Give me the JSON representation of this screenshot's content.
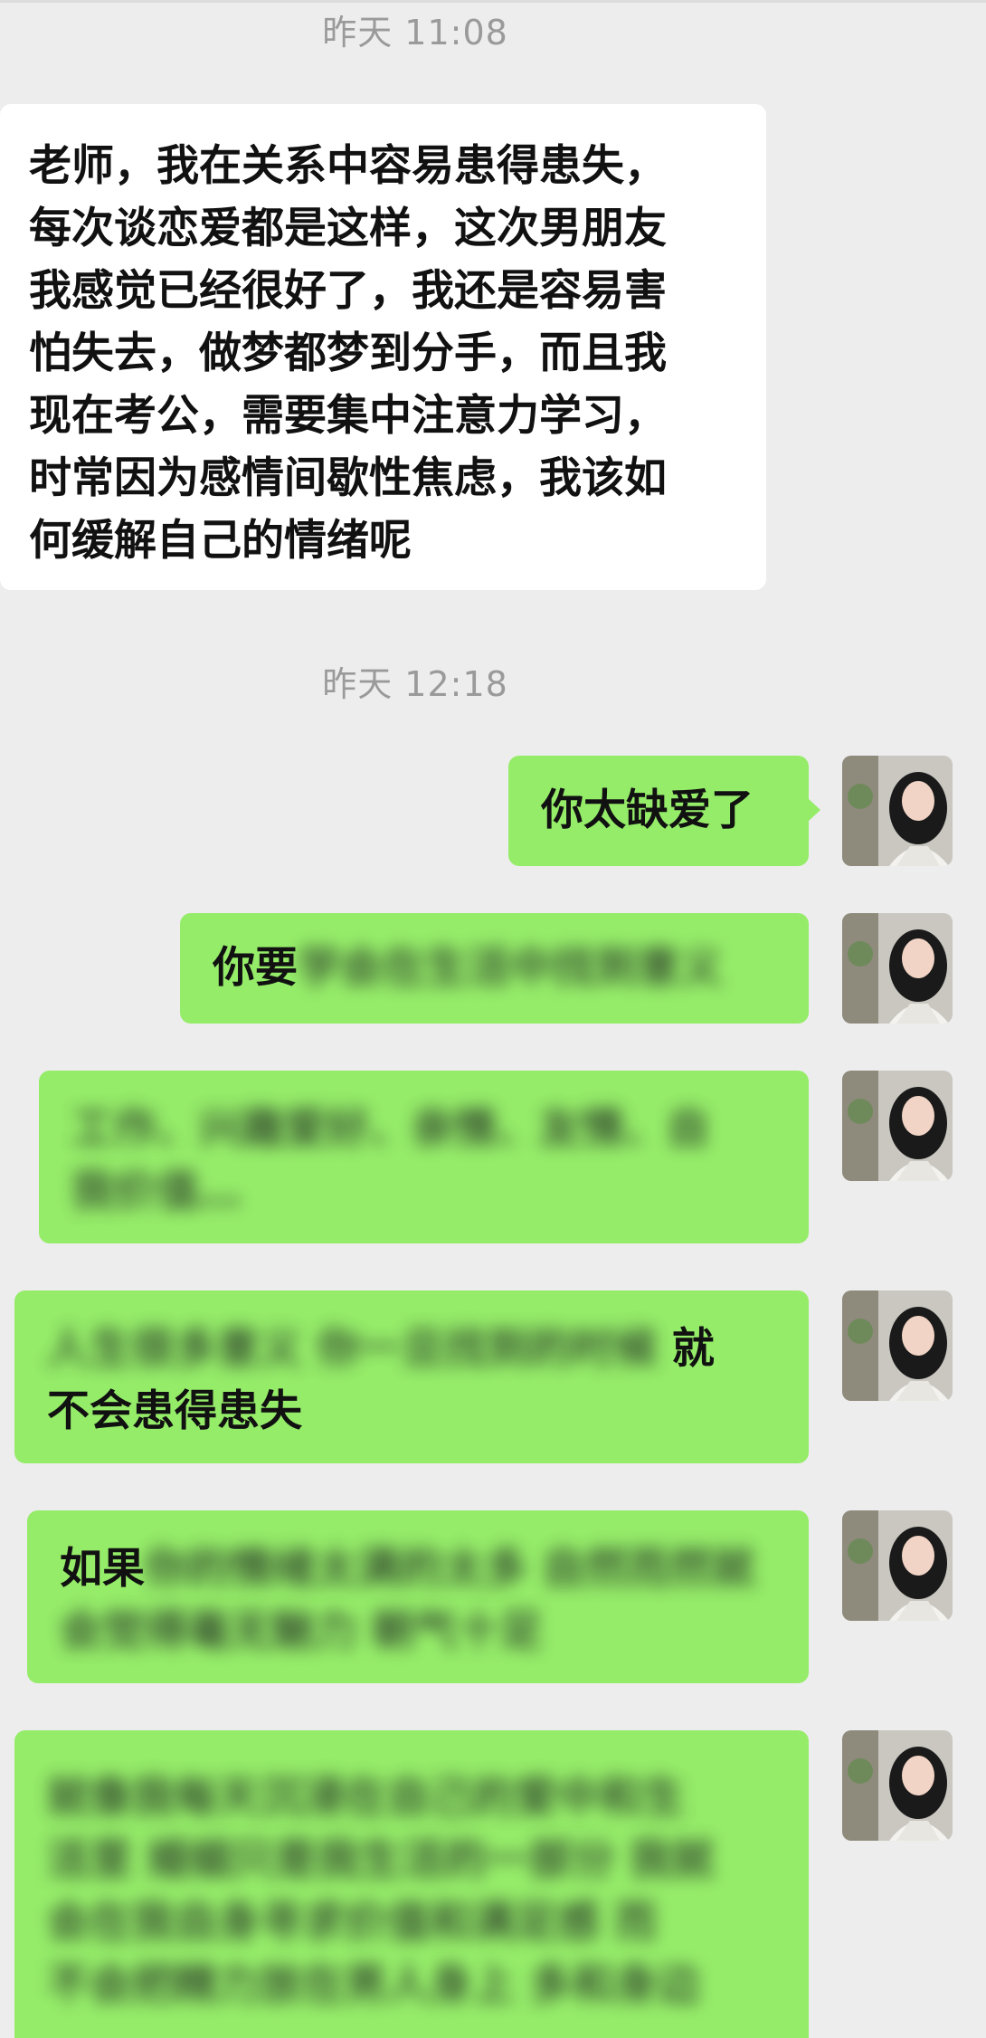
{
  "timestamps": [
    "昨天 11:08",
    "昨天 12:18"
  ],
  "incoming": {
    "lines": [
      "老师，我在关系中容易患得患失，",
      "每次谈恋爱都是这样，这次男朋友",
      "我感觉已经很好了，我还是容易害",
      "怕失去，做梦都梦到分手，而且我",
      "现在考公，需要集中注意力学习，",
      "时常因为感情间歇性焦虑，我该如",
      "何缓解自己的情绪呢"
    ]
  },
  "outgoing": [
    {
      "text": "你太缺爱了"
    },
    {
      "visible": "你要",
      "blurred": "学会在生活中找到意义"
    },
    {
      "blurred_lines": [
        "工作、兴趣爱好、亲情、友情、自",
        "我价值…"
      ]
    },
    {
      "blurred": "人生很多意义 你一旦找到的时候",
      "visible_end": "就",
      "line2": "不会患得患失"
    },
    {
      "visible": "如果",
      "blurred_line1": "你的情绪太满的太多 自然而然就",
      "blurred_line2": "会觉得毫无魅力 朝气十足"
    },
    {
      "blurred_lines": [
        "就像我每天沉浸在自己的爱中和生",
        "活里 婚姻只是我生活的一部分 我就",
        "会在我自身寻求价值和满足感 而",
        "不会把精力放在男人身上 多和身边"
      ]
    }
  ],
  "colors": {
    "background": "#ededed",
    "incoming_bubble": "#ffffff",
    "outgoing_bubble": "#95ec69",
    "timestamp_text": "#9a9a9a"
  },
  "icons": {
    "avatar": "user-avatar-photo"
  }
}
